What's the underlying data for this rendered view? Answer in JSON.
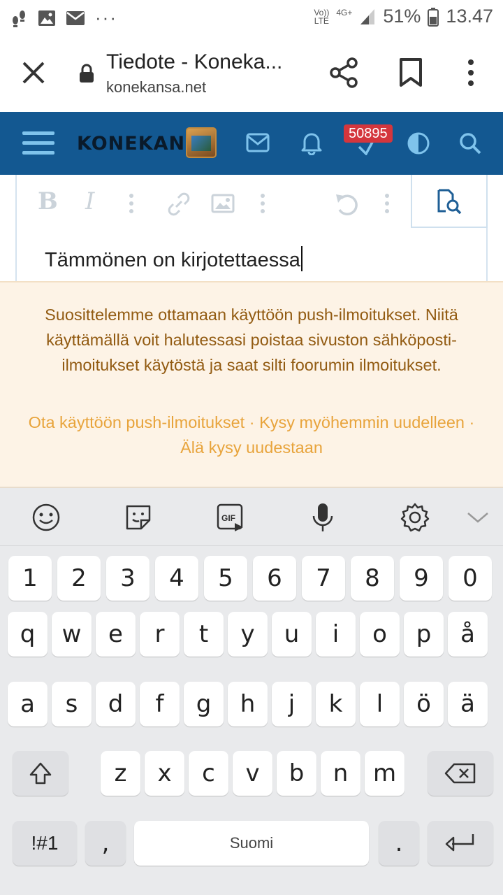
{
  "status_bar": {
    "battery": "51%",
    "time": "13.47",
    "network_top": "Vo))",
    "network_bottom": "LTE",
    "network_type": "4G+",
    "more": "···"
  },
  "browser": {
    "title": "Tiedote - Koneka...",
    "url": "konekansa.net"
  },
  "site_header": {
    "logo": "KONEKANSA",
    "badge_count": "50895",
    "colors": {
      "header_bg": "#135891",
      "badge_bg": "#d4363d"
    }
  },
  "editor": {
    "content": "Tämmönen on kirjotettaessa"
  },
  "notice": {
    "message": "Suosittelemme ottamaan käyttöön push-ilmoitukset. Niitä käyttämällä voit halutessasi poistaa sivuston sähköposti-ilmoitukset käytöstä ja saat silti foorumin ilmoitukset.",
    "link_enable": "Ota käyttöön push-ilmoitukset",
    "link_later": "Kysy myöhemmin uudelleen",
    "link_never": "Älä kysy uudestaan",
    "separator": "·"
  },
  "keyboard": {
    "row_numbers": [
      "1",
      "2",
      "3",
      "4",
      "5",
      "6",
      "7",
      "8",
      "9",
      "0"
    ],
    "row_top": [
      "q",
      "w",
      "e",
      "r",
      "t",
      "y",
      "u",
      "i",
      "o",
      "p",
      "å"
    ],
    "row_middle": [
      "a",
      "s",
      "d",
      "f",
      "g",
      "h",
      "j",
      "k",
      "l",
      "ö",
      "ä"
    ],
    "row_bottom": [
      "z",
      "x",
      "c",
      "v",
      "b",
      "n",
      "m"
    ],
    "symbols_label": "!#1",
    "comma": ",",
    "space_label": "Suomi",
    "period": ".",
    "gif_label": "GIF"
  }
}
